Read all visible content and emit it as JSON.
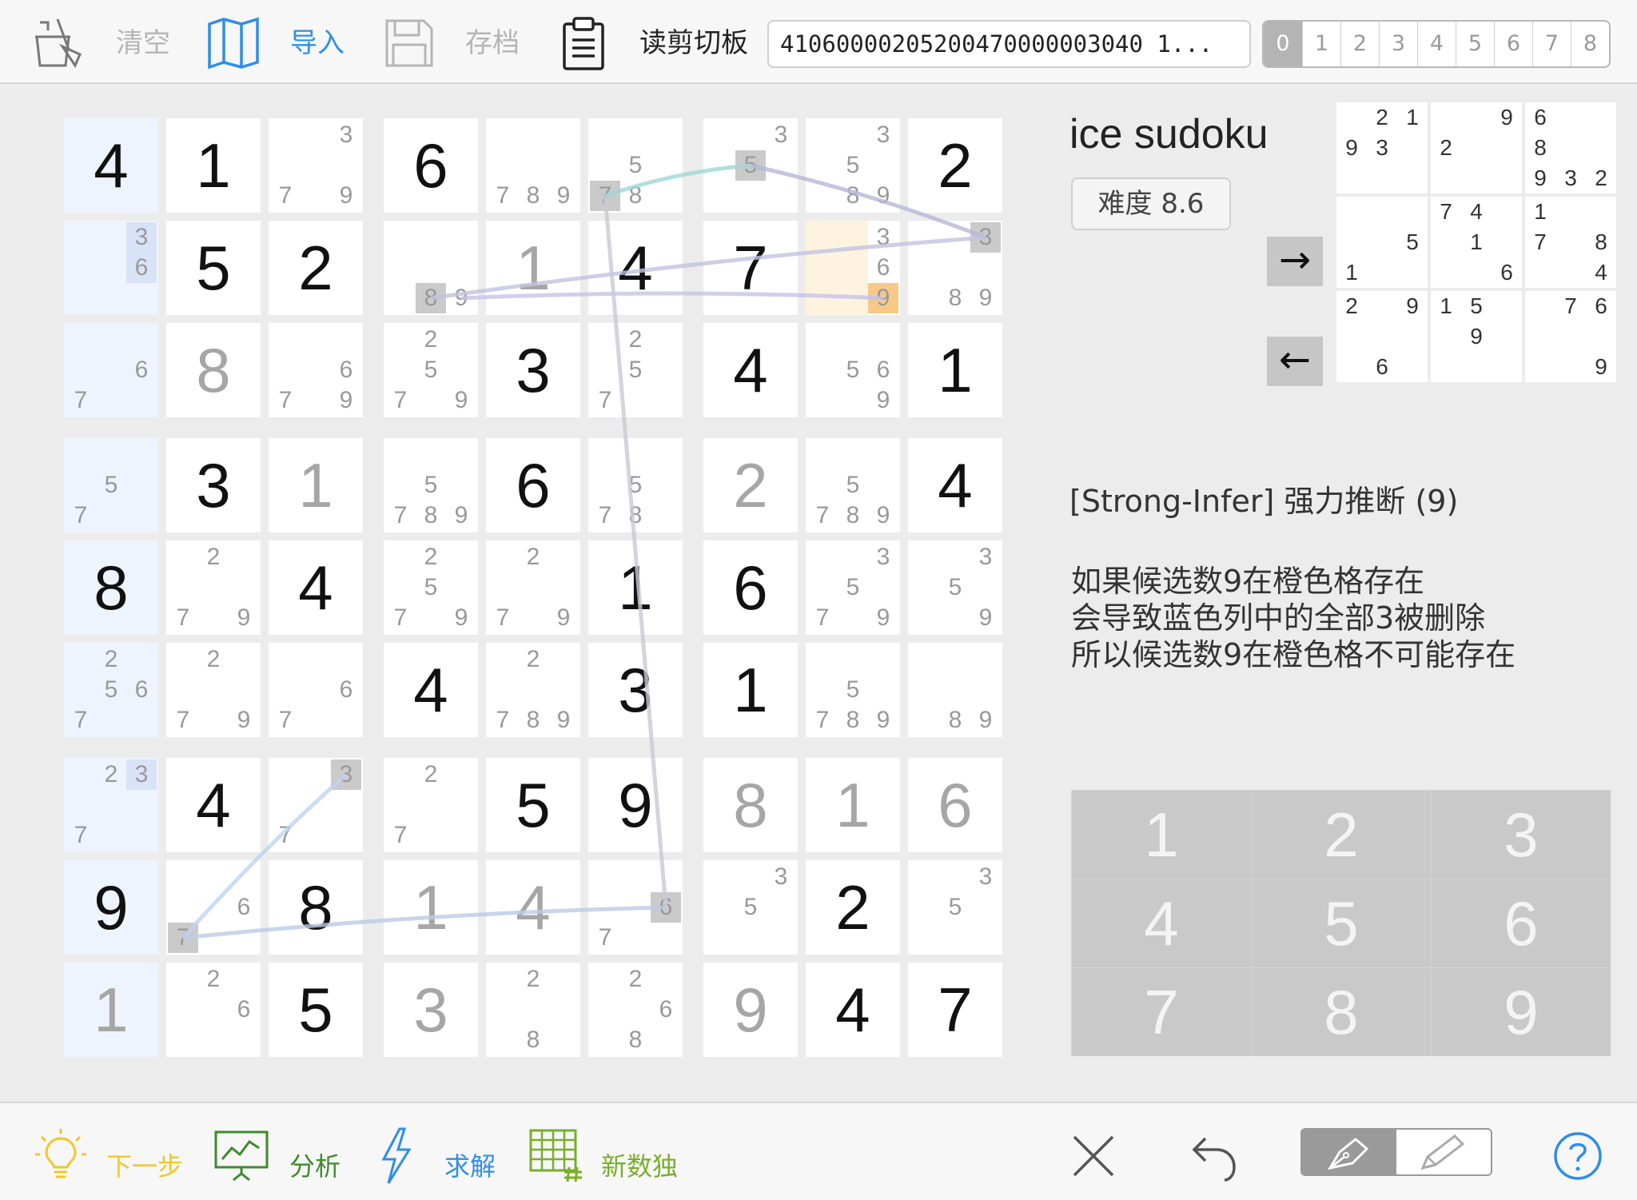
{
  "toolbar": {
    "clear_label": "清空",
    "import_label": "导入",
    "save_label": "存档",
    "clipboard_label": "读剪切板",
    "clipboard_value": "41060000205200470000003040 1...",
    "levels": [
      "0",
      "1",
      "2",
      "3",
      "4",
      "5",
      "6",
      "7",
      "8"
    ],
    "selected_level": "0",
    "colors": {
      "import": "#2f8ee6",
      "disabled": "#b5b5b5"
    }
  },
  "info": {
    "title": "ice sudoku",
    "difficulty": "难度 8.6",
    "next_arrow": "→",
    "prev_arrow": "←"
  },
  "hint": {
    "title": "[Strong-Infer] 强力推断 (9)",
    "lines": [
      "如果候选数9在橙色格存在",
      "会导致蓝色列中的全部3被删除",
      "所以候选数9在橙色格不可能存在"
    ]
  },
  "board": [
    [
      {
        "v": "4",
        "t": 1,
        "b": 1
      },
      {
        "v": "1",
        "t": 1
      },
      {
        "c": {
          "3": "",
          "7": "",
          "9": ""
        }
      },
      {
        "v": "6",
        "t": 1
      },
      {
        "c": {
          "7": "",
          "8": "",
          "9": ""
        }
      },
      {
        "c": {
          "5": "",
          "7": "h",
          "8": ""
        }
      },
      {
        "c": {
          "3": "",
          "5": "h"
        }
      },
      {
        "c": {
          "3": "",
          "5": "",
          "8": "",
          "9": ""
        }
      },
      {
        "v": "2",
        "t": 1
      }
    ],
    [
      {
        "c": {
          "3": "b",
          "6": "b"
        },
        "b": 1
      },
      {
        "v": "5",
        "t": 1
      },
      {
        "v": "2",
        "t": 1
      },
      {
        "c": {
          "8": "h",
          "9": ""
        }
      },
      {
        "v": "1",
        "t": 2
      },
      {
        "v": "4",
        "t": 1
      },
      {
        "v": "7",
        "t": 1
      },
      {
        "c": {
          "3": "",
          "6": "",
          "9": "o"
        },
        "o": 1
      },
      {
        "c": {
          "3": "h",
          "8": "",
          "9": ""
        }
      }
    ],
    [
      {
        "c": {
          "6": "",
          "7": ""
        },
        "b": 1
      },
      {
        "v": "8",
        "t": 2
      },
      {
        "c": {
          "6": "",
          "7": "",
          "9": ""
        }
      },
      {
        "c": {
          "2": "",
          "5": "",
          "7": "",
          "9": ""
        }
      },
      {
        "v": "3",
        "t": 1
      },
      {
        "c": {
          "2": "",
          "5": "",
          "7": ""
        }
      },
      {
        "v": "4",
        "t": 1
      },
      {
        "c": {
          "5": "",
          "6": "",
          "9": ""
        }
      },
      {
        "v": "1",
        "t": 1
      }
    ],
    [
      {
        "c": {
          "5": "",
          "7": ""
        },
        "b": 1
      },
      {
        "v": "3",
        "t": 1
      },
      {
        "v": "1",
        "t": 2
      },
      {
        "c": {
          "5": "",
          "7": "",
          "8": "",
          "9": ""
        }
      },
      {
        "v": "6",
        "t": 1
      },
      {
        "c": {
          "5": "",
          "7": "",
          "8": ""
        }
      },
      {
        "v": "2",
        "t": 2
      },
      {
        "c": {
          "5": "",
          "7": "",
          "8": "",
          "9": ""
        }
      },
      {
        "v": "4",
        "t": 1
      }
    ],
    [
      {
        "v": "8",
        "t": 1,
        "b": 1
      },
      {
        "c": {
          "2": "",
          "7": "",
          "9": ""
        }
      },
      {
        "v": "4",
        "t": 1
      },
      {
        "c": {
          "2": "",
          "5": "",
          "7": "",
          "9": ""
        }
      },
      {
        "c": {
          "2": "",
          "7": "",
          "9": ""
        }
      },
      {
        "v": "1",
        "t": 1
      },
      {
        "v": "6",
        "t": 1
      },
      {
        "c": {
          "3": "",
          "5": "",
          "7": "",
          "9": ""
        }
      },
      {
        "c": {
          "3": "",
          "5": "",
          "9": ""
        }
      }
    ],
    [
      {
        "c": {
          "2": "",
          "5": "",
          "6": "",
          "7": ""
        },
        "b": 1
      },
      {
        "c": {
          "2": "",
          "7": "",
          "9": ""
        }
      },
      {
        "c": {
          "6": "",
          "7": ""
        }
      },
      {
        "v": "4",
        "t": 1
      },
      {
        "c": {
          "2": "",
          "7": "",
          "8": "",
          "9": ""
        }
      },
      {
        "v": "3",
        "t": 1
      },
      {
        "v": "1",
        "t": 1
      },
      {
        "c": {
          "5": "",
          "7": "",
          "8": "",
          "9": ""
        }
      },
      {
        "c": {
          "8": "",
          "9": ""
        }
      }
    ],
    [
      {
        "c": {
          "2": "",
          "3": "b",
          "7": ""
        },
        "b": 1
      },
      {
        "v": "4",
        "t": 1
      },
      {
        "c": {
          "3": "h",
          "7": ""
        }
      },
      {
        "c": {
          "2": "",
          "7": ""
        }
      },
      {
        "v": "5",
        "t": 1
      },
      {
        "v": "9",
        "t": 1
      },
      {
        "v": "8",
        "t": 2
      },
      {
        "v": "1",
        "t": 2
      },
      {
        "v": "6",
        "t": 2
      }
    ],
    [
      {
        "v": "9",
        "t": 1,
        "b": 1
      },
      {
        "c": {
          "6": "",
          "7": "h"
        }
      },
      {
        "v": "8",
        "t": 1
      },
      {
        "v": "1",
        "t": 2
      },
      {
        "v": "4",
        "t": 2
      },
      {
        "c": {
          "6": "h",
          "7": ""
        }
      },
      {
        "c": {
          "3": "",
          "5": ""
        }
      },
      {
        "v": "2",
        "t": 1
      },
      {
        "c": {
          "3": "",
          "5": ""
        }
      }
    ],
    [
      {
        "v": "1",
        "t": 2,
        "b": 1
      },
      {
        "c": {
          "2": "",
          "6": ""
        }
      },
      {
        "v": "5",
        "t": 1
      },
      {
        "v": "3",
        "t": 2
      },
      {
        "c": {
          "2": "",
          "8": ""
        }
      },
      {
        "c": {
          "2": "",
          "6": "",
          "8": ""
        }
      },
      {
        "v": "9",
        "t": 2
      },
      {
        "v": "4",
        "t": 1
      },
      {
        "v": "7",
        "t": 1
      }
    ]
  ],
  "mini_board": [
    [
      "",
      "2",
      "1",
      "",
      "",
      "9",
      "6",
      "",
      ""
    ],
    [
      "9",
      "3",
      "",
      "2",
      "",
      "",
      "8",
      "",
      ""
    ],
    [
      "",
      "",
      "",
      "",
      "",
      "",
      "9",
      "3",
      "2"
    ],
    [
      "",
      "",
      "",
      "7",
      "4",
      "",
      "1",
      "",
      ""
    ],
    [
      "",
      "",
      "5",
      "",
      "1",
      "",
      "7",
      "",
      "8"
    ],
    [
      "1",
      "",
      "",
      "",
      "",
      "6",
      "",
      "",
      "4"
    ],
    [
      "2",
      "",
      "9",
      "1",
      "5",
      "",
      "",
      "7",
      "6"
    ],
    [
      "",
      "",
      "",
      "",
      "9",
      "",
      "",
      "",
      ""
    ],
    [
      "",
      "6",
      "",
      "",
      "",
      "",
      "",
      "",
      "9"
    ]
  ],
  "keypad": [
    "1",
    "2",
    "3",
    "4",
    "5",
    "6",
    "7",
    "8",
    "9"
  ],
  "bottom": {
    "next_label": "下一步",
    "analyze_label": "分析",
    "solve_label": "求解",
    "new_label": "新数独",
    "colors": {
      "next": "#f2c62c",
      "analyze": "#3f8a2e",
      "solve": "#2f8ee6",
      "new": "#7aae28"
    }
  }
}
